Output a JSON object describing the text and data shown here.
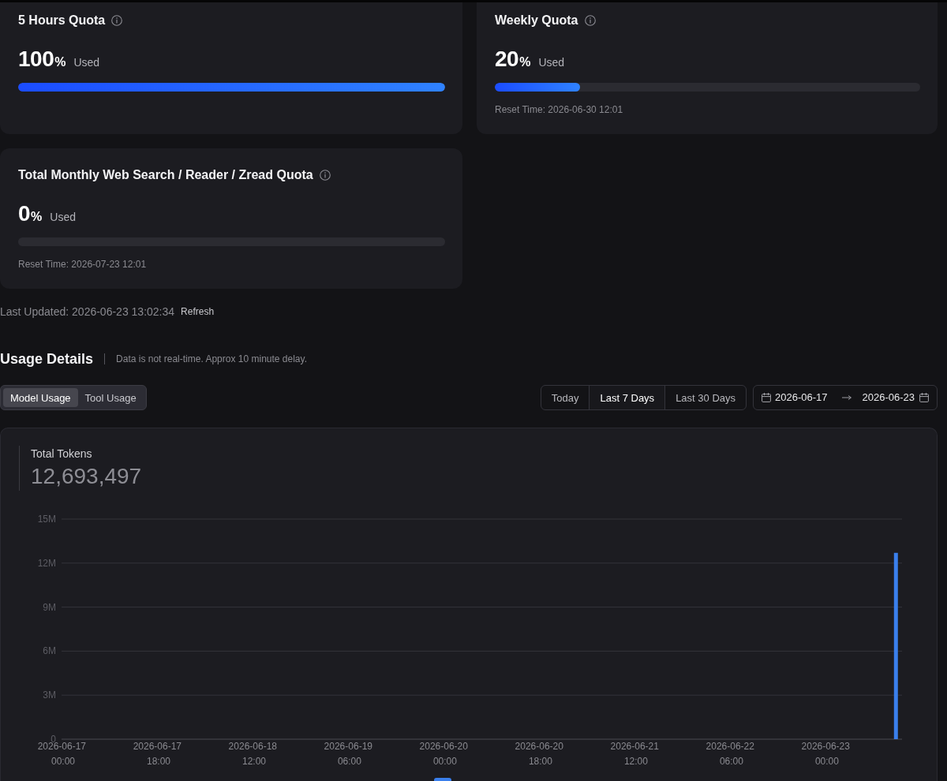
{
  "quotas": [
    {
      "title": "5 Hours Quota",
      "value": "100",
      "unit": "%",
      "suffix": "Used",
      "level": 1
    },
    {
      "title": "Weekly Quota",
      "value": "20",
      "unit": "%",
      "suffix": "Used",
      "level": 0.2,
      "reset": "Reset Time: 2026-06-30 12:01"
    },
    {
      "title": "Total Monthly Web Search / Reader / Zread Quota",
      "value": "0",
      "unit": "%",
      "suffix": "Used",
      "level": 0,
      "reset": "Reset Time: 2026-07-23 12:01"
    }
  ],
  "last_updated": {
    "label": "Last Updated: 2026-06-23 13:02:34",
    "action": "Refresh"
  },
  "usage": {
    "title": "Usage Details",
    "note": "Data is not real-time. Approx 10 minute delay.",
    "view_tabs": [
      {
        "label": "Model Usage",
        "selected": true
      },
      {
        "label": "Tool Usage",
        "selected": false
      }
    ],
    "periods": [
      {
        "label": "Today",
        "selected": false
      },
      {
        "label": "Last 7 Days",
        "selected": true
      },
      {
        "label": "Last 30 Days",
        "selected": false
      }
    ],
    "date_range": {
      "start": "2026-06-17",
      "end": "2026-06-23"
    },
    "total": {
      "label": "Total Tokens",
      "value": "12,693,497"
    },
    "chart_data": {
      "type": "bar",
      "grid": true,
      "ylim": [
        0,
        15000000
      ],
      "yticks": [
        {
          "value": 0,
          "label": "0"
        },
        {
          "value": 3000000,
          "label": "3M"
        },
        {
          "value": 6000000,
          "label": "6M"
        },
        {
          "value": 9000000,
          "label": "9M"
        },
        {
          "value": 12000000,
          "label": "12M"
        },
        {
          "value": 15000000,
          "label": "15M"
        }
      ],
      "categories": [
        "2026-06-17 00:00",
        null,
        null,
        null,
        null,
        null,
        null,
        null,
        null,
        null,
        null,
        null,
        null,
        null,
        null,
        null,
        null,
        null,
        "2026-06-17 18:00",
        null,
        null,
        null,
        null,
        null,
        null,
        null,
        null,
        null,
        null,
        null,
        null,
        null,
        null,
        null,
        null,
        null,
        "2026-06-18 12:00",
        null,
        null,
        null,
        null,
        null,
        null,
        null,
        null,
        null,
        null,
        null,
        null,
        null,
        null,
        null,
        null,
        null,
        "2026-06-19 06:00",
        null,
        null,
        null,
        null,
        null,
        null,
        null,
        null,
        null,
        null,
        null,
        null,
        null,
        null,
        null,
        null,
        null,
        "2026-06-20 00:00",
        null,
        null,
        null,
        null,
        null,
        null,
        null,
        null,
        null,
        null,
        null,
        null,
        null,
        null,
        null,
        null,
        null,
        "2026-06-20 18:00",
        null,
        null,
        null,
        null,
        null,
        null,
        null,
        null,
        null,
        null,
        null,
        null,
        null,
        null,
        null,
        null,
        null,
        "2026-06-21 12:00",
        null,
        null,
        null,
        null,
        null,
        null,
        null,
        null,
        null,
        null,
        null,
        null,
        null,
        null,
        null,
        null,
        null,
        "2026-06-22 06:00",
        null,
        null,
        null,
        null,
        null,
        null,
        null,
        null,
        null,
        null,
        null,
        null,
        null,
        null,
        null,
        null,
        null,
        "2026-06-23 00:00",
        null,
        null,
        null,
        null,
        null,
        null,
        null,
        null,
        null,
        null,
        null,
        null,
        null
      ],
      "series": [
        {
          "color": "#3a7fec",
          "values": [
            null,
            null,
            null,
            null,
            null,
            null,
            null,
            null,
            null,
            null,
            null,
            null,
            null,
            null,
            null,
            null,
            null,
            null,
            null,
            null,
            null,
            null,
            null,
            null,
            null,
            null,
            null,
            null,
            null,
            null,
            null,
            null,
            null,
            null,
            null,
            null,
            null,
            null,
            null,
            null,
            null,
            null,
            null,
            null,
            null,
            null,
            null,
            null,
            null,
            null,
            null,
            null,
            null,
            null,
            null,
            null,
            null,
            null,
            null,
            null,
            null,
            null,
            null,
            null,
            null,
            null,
            null,
            null,
            null,
            null,
            null,
            null,
            null,
            null,
            null,
            null,
            null,
            null,
            null,
            null,
            null,
            null,
            null,
            null,
            null,
            null,
            null,
            null,
            null,
            null,
            null,
            null,
            null,
            null,
            null,
            null,
            null,
            null,
            null,
            null,
            null,
            null,
            null,
            null,
            null,
            null,
            null,
            null,
            null,
            null,
            null,
            null,
            null,
            null,
            null,
            null,
            null,
            null,
            null,
            null,
            null,
            null,
            null,
            null,
            null,
            null,
            null,
            null,
            null,
            null,
            null,
            null,
            null,
            null,
            null,
            null,
            null,
            null,
            null,
            null,
            null,
            null,
            null,
            null,
            null,
            null,
            null,
            null,
            null,
            null,
            null,
            null,
            null,
            null,
            null,
            null,
            null,
            12700000
          ]
        }
      ]
    }
  }
}
